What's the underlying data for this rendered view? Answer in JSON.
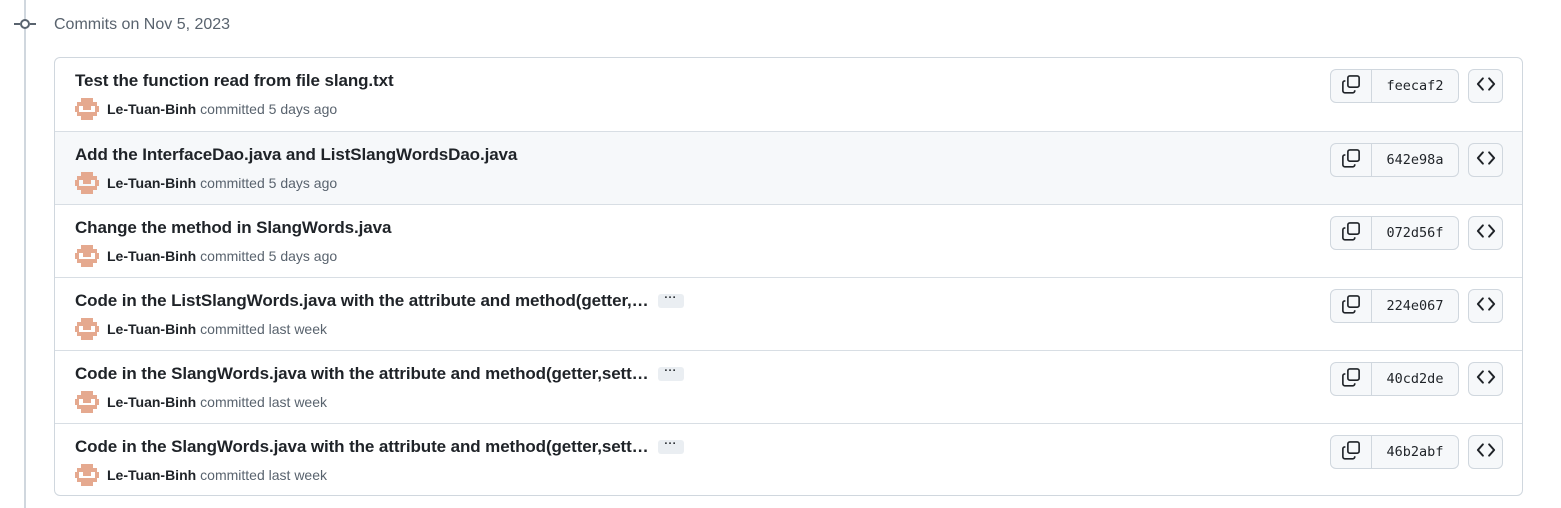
{
  "group": {
    "header": "Commits on Nov 5, 2023"
  },
  "commits": [
    {
      "title": "Test the function read from file slang.txt",
      "truncated": false,
      "author": "Le-Tuan-Binh",
      "verb": "committed",
      "time": "5 days ago",
      "sha": "feecaf2"
    },
    {
      "title": "Add the InterfaceDao.java and ListSlangWordsDao.java",
      "truncated": false,
      "author": "Le-Tuan-Binh",
      "verb": "committed",
      "time": "5 days ago",
      "sha": "642e98a"
    },
    {
      "title": "Change the method in SlangWords.java",
      "truncated": false,
      "author": "Le-Tuan-Binh",
      "verb": "committed",
      "time": "5 days ago",
      "sha": "072d56f"
    },
    {
      "title": "Code in the ListSlangWords.java with the attribute and method(getter,…",
      "truncated": true,
      "author": "Le-Tuan-Binh",
      "verb": "committed",
      "time": "last week",
      "sha": "224e067"
    },
    {
      "title": "Code in the SlangWords.java with the attribute and method(getter,sett…",
      "truncated": true,
      "author": "Le-Tuan-Binh",
      "verb": "committed",
      "time": "last week",
      "sha": "40cd2de"
    },
    {
      "title": "Code in the SlangWords.java with the attribute and method(getter,sett…",
      "truncated": true,
      "author": "Le-Tuan-Binh",
      "verb": "committed",
      "time": "last week",
      "sha": "46b2abf"
    }
  ],
  "ellipsis_label": "···",
  "icons": {
    "copy": "copy-icon",
    "browse": "code-icon",
    "commit": "git-commit-icon"
  },
  "colors": {
    "border": "#d0d7de",
    "muted": "#59636e",
    "avatar": "#e5a98f",
    "hover_row": "#f6f8fa"
  }
}
